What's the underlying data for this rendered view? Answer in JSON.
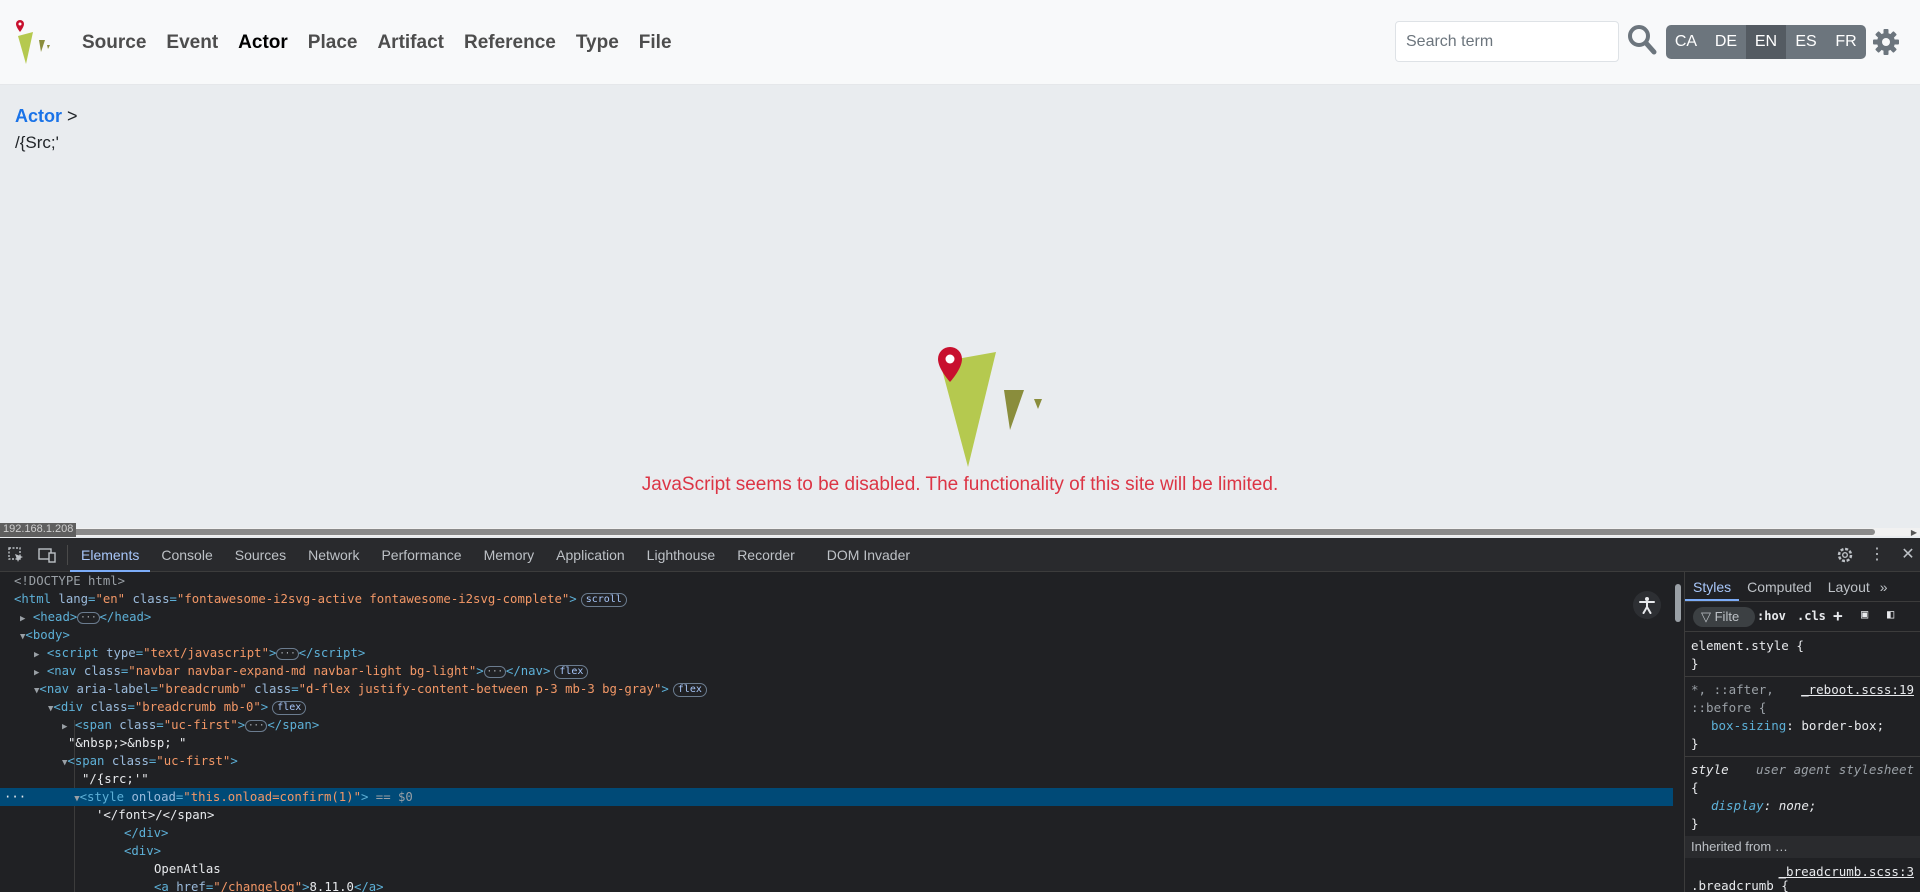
{
  "navbar": {
    "links": [
      {
        "label": "Source",
        "active": false
      },
      {
        "label": "Event",
        "active": false
      },
      {
        "label": "Actor",
        "active": true
      },
      {
        "label": "Place",
        "active": false
      },
      {
        "label": "Artifact",
        "active": false
      },
      {
        "label": "Reference",
        "active": false
      },
      {
        "label": "Type",
        "active": false
      },
      {
        "label": "File",
        "active": false
      }
    ],
    "search_placeholder": "Search term",
    "languages": [
      "CA",
      "DE",
      "EN",
      "ES",
      "FR"
    ],
    "active_language": "EN"
  },
  "breadcrumb": {
    "link": "Actor",
    "separator": ">",
    "current": "/{Src;'"
  },
  "message": "JavaScript seems to be disabled. The functionality of this site will be limited.",
  "ip_label": "192.168.1.208",
  "devtools": {
    "tabs": [
      "Elements",
      "Console",
      "Sources",
      "Network",
      "Performance",
      "Memory",
      "Application",
      "Lighthouse",
      "Recorder",
      "DOM Invader"
    ],
    "active_tab": "Elements",
    "dom": {
      "doctype": "<!DOCTYPE html>",
      "html_lang": "en",
      "html_class": "fontawesome-i2svg-active fontawesome-i2svg-complete",
      "badge_scroll": "scroll",
      "badge_flex": "flex",
      "script_type": "text/javascript",
      "nav1_class": "navbar navbar-expand-md navbar-light bg-light",
      "nav2_label": "breadcrumb",
      "nav2_class": "d-flex justify-content-between p-3 mb-3 bg-gray",
      "div_class": "breadcrumb mb-0",
      "span_class": "uc-first",
      "text_nbsp": "\"&nbsp;>&nbsp; \"",
      "text_src": "\"/{src;'\"",
      "style_onload": "this.onload=confirm(1)",
      "selected_marker": "== $0",
      "text_font": "'</font>/</span>",
      "close_div": "</div>",
      "open_div": "<div>",
      "openatlas": "OpenAtlas",
      "changelog_href": "/changelog",
      "version": "8.11.0"
    },
    "styles": {
      "tabs": [
        "Styles",
        "Computed",
        "Layout"
      ],
      "active_tab": "Styles",
      "filter_placeholder": "Filte",
      "hov": ":hov",
      "cls": ".cls",
      "rule1_selector": "element.style {",
      "rule1_close": "}",
      "rule2_selector": "*, ::after,",
      "rule2_selector2": "::before {",
      "rule2_source": "_reboot.scss:19",
      "rule2_prop": "box-sizing",
      "rule2_val": "border-box;",
      "rule2_close": "}",
      "rule3_selector": "style",
      "rule3_source": "user agent stylesheet",
      "rule3_open": "{",
      "rule3_prop": "display",
      "rule3_val": "none;",
      "rule3_close": "}",
      "inherited": "Inherited from …",
      "rule4_source": "_breadcrumb.scss:3",
      "rule4_selector": ".breadcrumb {"
    }
  },
  "colors": {
    "logo_green": "#b5c94f",
    "logo_dark_green": "#8a8d3c",
    "pin_red": "#c8102e",
    "message_red": "#dc3545",
    "link_blue": "#1a73e8"
  }
}
